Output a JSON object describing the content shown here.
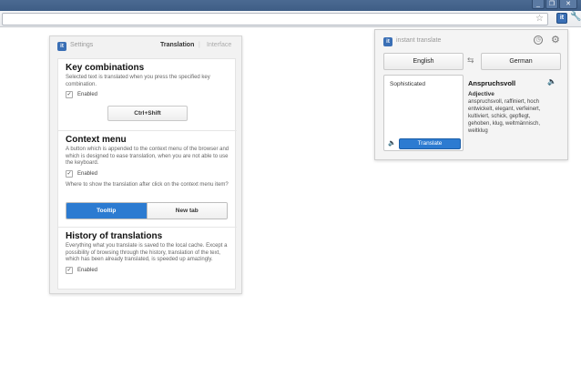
{
  "browser": {
    "window_buttons": [
      "_",
      "❐",
      "✕"
    ],
    "extension_icon_letter": "it"
  },
  "settings": {
    "title": "Settings",
    "tabs": {
      "translation": "Translation",
      "interface": "Interface"
    },
    "key_combinations": {
      "heading": "Key combinations",
      "description": "Selected text is translated when you press the specified key combination.",
      "enabled_label": "Enabled",
      "hotkey": "Ctrl+Shift"
    },
    "context_menu": {
      "heading": "Context menu",
      "description": "A button which is appended to the context menu of the browser and which is designed to ease translation, when you are not able to use the keyboard.",
      "enabled_label": "Enabled",
      "question": "Where to show the translation after click on the context menu item?",
      "options": [
        "Tooltip",
        "New tab"
      ],
      "selected": "Tooltip"
    },
    "history": {
      "heading": "History of translations",
      "description": "Everything what you translate is saved to the local cache. Except a possibility of browsing through the history, translation of the text, which has been already translated, is speeded up amazingly.",
      "enabled_label": "Enabled"
    }
  },
  "popup": {
    "title": "instant translate",
    "source_lang": "English",
    "target_lang": "German",
    "input_text": "Sophisticated",
    "translate_label": "Translate",
    "result": {
      "word": "Anspruchsvoll",
      "part_of_speech": "Adjective",
      "synonyms": "anspruchsvoll, raffiniert, hoch entwickelt, elegant, verfeinert, kultiviert, schick, gepflegt, gehoben, klug, weltmännisch, weltklug"
    }
  }
}
